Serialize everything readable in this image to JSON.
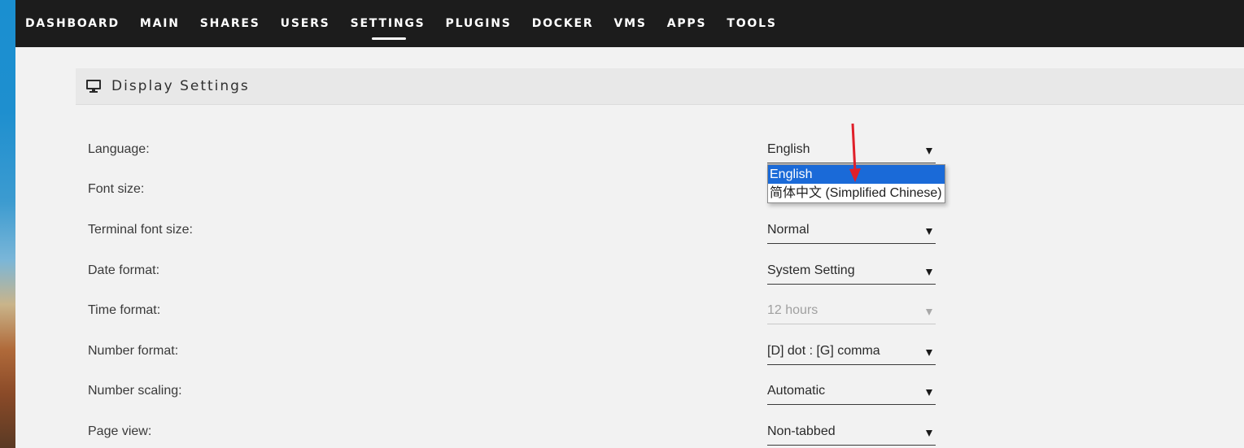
{
  "nav": {
    "items": [
      {
        "label": "DASHBOARD"
      },
      {
        "label": "MAIN"
      },
      {
        "label": "SHARES"
      },
      {
        "label": "USERS"
      },
      {
        "label": "SETTINGS"
      },
      {
        "label": "PLUGINS"
      },
      {
        "label": "DOCKER"
      },
      {
        "label": "VMS"
      },
      {
        "label": "APPS"
      },
      {
        "label": "TOOLS"
      }
    ],
    "active": "SETTINGS"
  },
  "section": {
    "title": "Display Settings",
    "icon": "monitor-icon"
  },
  "settings": [
    {
      "label": "Language:",
      "value": "English",
      "disabled": false
    },
    {
      "label": "Font size:",
      "value": "",
      "disabled": false
    },
    {
      "label": "Terminal font size:",
      "value": "Normal",
      "disabled": false
    },
    {
      "label": "Date format:",
      "value": "System Setting",
      "disabled": false
    },
    {
      "label": "Time format:",
      "value": "12 hours",
      "disabled": true
    },
    {
      "label": "Number format:",
      "value": "[D] dot : [G] comma",
      "disabled": false
    },
    {
      "label": "Number scaling:",
      "value": "Automatic",
      "disabled": false
    },
    {
      "label": "Page view:",
      "value": "Non-tabbed",
      "disabled": false
    }
  ],
  "language_dropdown": {
    "options": [
      {
        "label": "English",
        "selected": true
      },
      {
        "label": "简体中文 (Simplified Chinese)",
        "selected": false
      }
    ]
  },
  "colors": {
    "nav_bg": "#1c1c1c",
    "page_bg": "#f2f2f2",
    "selection": "#1a6ad8",
    "annotation_arrow": "#e0202a"
  }
}
